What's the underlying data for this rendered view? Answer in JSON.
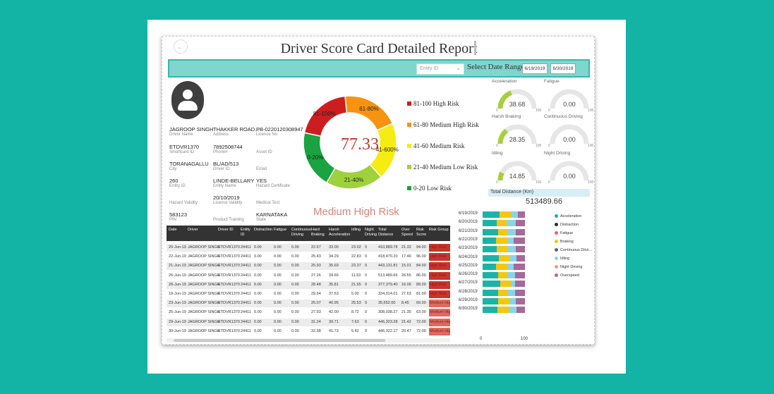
{
  "header": {
    "title": "Driver Score Card Detailed Report"
  },
  "filters": {
    "entity_placeholder": "Entity ID",
    "date_range_label": "Select Date Range",
    "date_from": "6/19/2019",
    "date_to": "6/30/2019"
  },
  "driver": {
    "fields": [
      {
        "value": "JAGROOP SINGH",
        "label": "Driver Name"
      },
      {
        "value": "THAKKER ROAD...",
        "label": "Address"
      },
      {
        "value": "PB-0220120308947",
        "label": "Licence No"
      },
      {
        "value": "ETDVR1370",
        "label": "Smartcard ID"
      },
      {
        "value": "7892508744",
        "label": "Phone#"
      },
      {
        "value": "",
        "label": "Asset ID"
      },
      {
        "value": "TORANAGALLU",
        "label": "City"
      },
      {
        "value": "BL/AD/513",
        "label": "Driver ID"
      },
      {
        "value": "",
        "label": "Email"
      },
      {
        "value": "260",
        "label": "Entity ID"
      },
      {
        "value": "LINDE-BELLARY",
        "label": "Entity Name"
      },
      {
        "value": "YES",
        "label": "Hazard Certificate"
      },
      {
        "value": "",
        "label": "Hazard Validity"
      },
      {
        "value": "20/10/2019",
        "label": "Licence Validity"
      },
      {
        "value": "",
        "label": "Medical Test"
      },
      {
        "value": "583123",
        "label": "PIN"
      },
      {
        "value": "",
        "label": "Product Training"
      },
      {
        "value": "KARNATAKA",
        "label": "State"
      }
    ]
  },
  "gauge": {
    "score": "77.33",
    "segments": [
      {
        "label": "0-20%",
        "color": "#1aa340"
      },
      {
        "label": "81-100%",
        "color": "#cc1e1e"
      },
      {
        "label": "61-80%",
        "color": "#f7930f"
      },
      {
        "label": "41-600%",
        "color": "#f5ec12"
      },
      {
        "label": "21-40%",
        "color": "#9ed13b"
      }
    ],
    "risk_group": "Medium High Risk"
  },
  "risk_legend": [
    {
      "label": "81-100 High Risk",
      "color": "#cc1e1e"
    },
    {
      "label": "61-80 Medium High Risk",
      "color": "#f7930f"
    },
    {
      "label": "41-60 Medium Risk",
      "color": "#f5ec12"
    },
    {
      "label": "21-40 Medium Low Risk",
      "color": "#9ed13b"
    },
    {
      "label": "0-20 Low Risk",
      "color": "#1aa340"
    }
  ],
  "mini_gauges": [
    {
      "label": "Acceleration",
      "value": "38.68",
      "fraction": 0.3868,
      "min": "0",
      "max": "100"
    },
    {
      "label": "Fatigue",
      "value": "0.00",
      "fraction": 0,
      "min": "0",
      "max": "100"
    },
    {
      "label": "Harsh Braking",
      "value": "28.35",
      "fraction": 0.2835,
      "min": "0",
      "max": "100"
    },
    {
      "label": "Continuous Driving",
      "value": "0.00",
      "fraction": 0,
      "min": "0",
      "max": "100"
    },
    {
      "label": "Idling",
      "value": "14.85",
      "fraction": 0.1485,
      "min": "0",
      "max": "100"
    },
    {
      "label": "Night Driving",
      "value": "0.00",
      "fraction": 0,
      "min": "0",
      "max": "100"
    }
  ],
  "distance": {
    "label": "Total Distance (Km)",
    "value": "513489.66"
  },
  "table": {
    "headers": [
      "Date",
      "Driver",
      "Driver ID",
      "Entity ID",
      "Distraction",
      "Fatigue",
      "Continuous Driving",
      "Hard Braking",
      "Harsh Acceleration",
      "Idling",
      "Night Driving",
      "Total Distance",
      "Over Speed",
      "Risk Score",
      "Risk Group"
    ],
    "rows": [
      [
        "20-Jun-19",
        "JAGROOP SINGH",
        "ETDVR1370",
        "24411",
        "0.00",
        "0.00",
        "0.00",
        "22.67",
        "33.00",
        "23.02",
        "0",
        "410,889.78",
        "21.32",
        "94.00",
        "High Risk"
      ],
      [
        "22-Jun-19",
        "JAGROOP SINGH",
        "ETDVR1370",
        "24411",
        "0.00",
        "0.00",
        "0.00",
        "25.43",
        "34.29",
        "22.83",
        "0",
        "418,470.20",
        "17.46",
        "96.00",
        "High Risk"
      ],
      [
        "21-Jun-19",
        "JAGROOP SINGH",
        "ETDVR1370",
        "24411",
        "0.00",
        "0.00",
        "0.00",
        "25.93",
        "35.69",
        "23.37",
        "0",
        "443,131.81",
        "15.01",
        "84.00",
        "High Risk"
      ],
      [
        "26-Jun-19",
        "JAGROOP SINGH",
        "ETDVR1370",
        "24411",
        "0.00",
        "0.00",
        "0.00",
        "27.26",
        "34.66",
        "11.53",
        "0",
        "513,489.66",
        "26.55",
        "86.00",
        "High Risk"
      ],
      [
        "28-Jun-19",
        "JAGROOP SINGH",
        "ETDVR1370",
        "24411",
        "0.00",
        "0.00",
        "0.00",
        "28.48",
        "35.81",
        "21.65",
        "0",
        "377,379.40",
        "16.06",
        "89.00",
        "High Risk"
      ],
      [
        "19-Jun-19",
        "JAGROOP SINGH",
        "ETDVR1370",
        "24411",
        "0.00",
        "0.00",
        "0.00",
        "29.64",
        "37.53",
        "5.00",
        "0",
        "334,014.01",
        "27.63",
        "81.00",
        "High Risk"
      ],
      [
        "23-Jun-19",
        "JAGROOP SINGH",
        "ETDVR1370",
        "24411",
        "0.00",
        "0.00",
        "0.00",
        "25.07",
        "40.95",
        "25.53",
        "0",
        "35,652.00",
        "8.45",
        "69.00",
        "Medium High"
      ],
      [
        "25-Jun-19",
        "JAGROOP SINGH",
        "ETDVR1370",
        "24411",
        "0.00",
        "0.00",
        "0.00",
        "27.93",
        "42.00",
        "8.72",
        "0",
        "308,038.27",
        "21.35",
        "63.00",
        "Medium High"
      ],
      [
        "29-Jun-19",
        "JAGROOP SINGH",
        "ETDVR1370",
        "24411",
        "0.00",
        "0.00",
        "0.00",
        "31.24",
        "39.71",
        "7.63",
        "0",
        "446,323.28",
        "21.42",
        "72.00",
        "Medium High"
      ],
      [
        "30-Jun-19",
        "JAGROOP SINGH",
        "ETDVR1370",
        "24411",
        "0.00",
        "0.00",
        "0.00",
        "32.38",
        "41.73",
        "5.42",
        "0",
        "446,322.17",
        "20.47",
        "72.00",
        "Medium High"
      ]
    ]
  },
  "chart_data": {
    "type": "bar",
    "orientation": "horizontal",
    "stacked": true,
    "categories": [
      "6/19/2019",
      "6/20/2019",
      "6/21/2019",
      "6/22/2019",
      "6/23/2019",
      "6/24/2019",
      "6/25/2019",
      "6/26/2019",
      "6/27/2019",
      "6/28/2019",
      "6/29/2019",
      "6/30/2019"
    ],
    "xlim": [
      0,
      100
    ],
    "x_ticks": [
      "0",
      "100"
    ],
    "legend_position": "right",
    "series": [
      {
        "name": "Acceleration",
        "color": "#1bb3a7",
        "values": [
          40,
          33,
          36,
          32,
          34,
          39,
          32,
          37,
          41,
          36,
          36,
          35
        ]
      },
      {
        "name": "Distraction",
        "color": "#2b2b2b",
        "values": [
          0,
          0,
          0,
          0,
          0,
          0,
          0,
          0,
          0,
          0,
          0,
          0
        ]
      },
      {
        "name": "Fatigue",
        "color": "#e8646a",
        "values": [
          0,
          0,
          0,
          0,
          0,
          0,
          0,
          0,
          0,
          0,
          0,
          0
        ]
      },
      {
        "name": "Braking",
        "color": "#f2c811",
        "values": [
          26,
          24,
          22,
          28,
          26,
          24,
          27,
          22,
          25,
          23,
          28,
          26
        ]
      },
      {
        "name": "Continuous Drivi...",
        "color": "#5b6573",
        "values": [
          0,
          0,
          0,
          0,
          0,
          0,
          0,
          0,
          0,
          0,
          0,
          0
        ]
      },
      {
        "name": "Idling",
        "color": "#8ad4eb",
        "values": [
          18,
          21,
          20,
          13,
          18,
          17,
          14,
          18,
          10,
          17,
          15,
          19
        ]
      },
      {
        "name": "Night Driving",
        "color": "#fe9666",
        "values": [
          0,
          0,
          0,
          0,
          0,
          0,
          0,
          0,
          0,
          0,
          0,
          0
        ]
      },
      {
        "name": "Overspeed",
        "color": "#a66999",
        "values": [
          16,
          22,
          22,
          27,
          22,
          20,
          27,
          23,
          24,
          24,
          21,
          20
        ]
      }
    ]
  }
}
